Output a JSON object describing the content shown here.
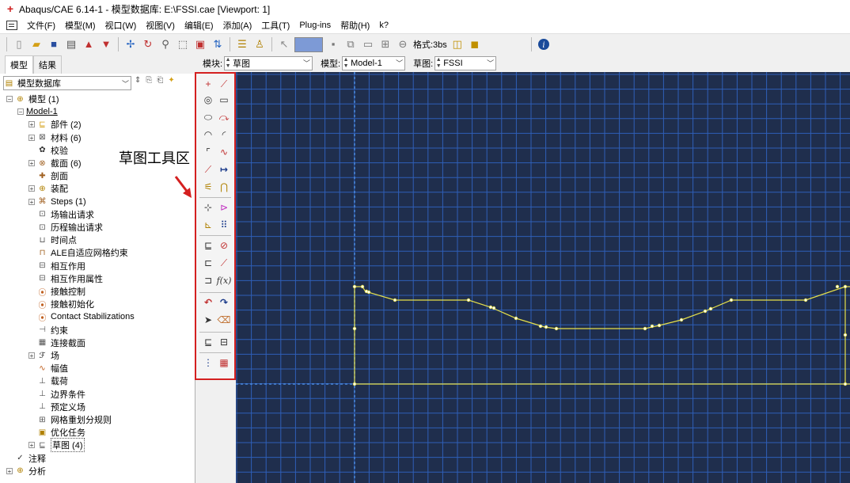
{
  "window": {
    "title": "Abaqus/CAE 6.14-1 - 模型数据库: E:\\FSSI.cae [Viewport: 1]"
  },
  "menu": [
    "文件(F)",
    "模型(M)",
    "视口(W)",
    "视图(V)",
    "编辑(E)",
    "添加(A)",
    "工具(T)",
    "Plug-ins",
    "帮助(H)",
    "k?"
  ],
  "toolbar": {
    "format_label": "格式:3bs"
  },
  "tabs": [
    "模型",
    "结果"
  ],
  "context": {
    "module_label": "模块:",
    "module_value": "草图",
    "model_label": "模型:",
    "model_value": "Model-1",
    "sketch_label": "草图:",
    "sketch_value": "FSSI"
  },
  "model_db_label": "模型数据库",
  "tree": [
    {
      "label": "模型 (1)",
      "icon": "models-icon"
    },
    {
      "label": "Model-1",
      "icon": ""
    },
    {
      "label": "部件 (2)",
      "icon": "parts-icon"
    },
    {
      "label": "材料 (6)",
      "icon": "materials-icon"
    },
    {
      "label": "校验",
      "icon": "calibration-icon"
    },
    {
      "label": "截面 (6)",
      "icon": "sections-icon"
    },
    {
      "label": "剖面",
      "icon": "profiles-icon"
    },
    {
      "label": "装配",
      "icon": "assembly-icon"
    },
    {
      "label": "Steps (1)",
      "icon": "steps-icon"
    },
    {
      "label": "场输出请求",
      "icon": "field-output-icon"
    },
    {
      "label": "历程输出请求",
      "icon": "history-output-icon"
    },
    {
      "label": "时间点",
      "icon": "time-points-icon"
    },
    {
      "label": "ALE自适应网格约束",
      "icon": "ale-icon"
    },
    {
      "label": "相互作用",
      "icon": "interactions-icon"
    },
    {
      "label": "相互作用属性",
      "icon": "interaction-props-icon"
    },
    {
      "label": "接触控制",
      "icon": "contact-controls-icon"
    },
    {
      "label": "接触初始化",
      "icon": "contact-init-icon"
    },
    {
      "label": "Contact Stabilizations",
      "icon": "contact-stab-icon"
    },
    {
      "label": "约束",
      "icon": "constraints-icon"
    },
    {
      "label": "连接截面",
      "icon": "connector-sections-icon"
    },
    {
      "label": "场",
      "icon": "fields-icon"
    },
    {
      "label": "幅值",
      "icon": "amplitudes-icon"
    },
    {
      "label": "载荷",
      "icon": "loads-icon"
    },
    {
      "label": "边界条件",
      "icon": "bcs-icon"
    },
    {
      "label": "预定义场",
      "icon": "predefined-fields-icon"
    },
    {
      "label": "网格重划分规则",
      "icon": "remesh-icon"
    },
    {
      "label": "优化任务",
      "icon": "optimization-icon"
    },
    {
      "label": "草图 (4)",
      "icon": "sketches-icon"
    },
    {
      "label": "注释",
      "icon": "annotations-icon"
    },
    {
      "label": "分析",
      "icon": "analysis-icon"
    }
  ],
  "annotation": {
    "label": "草图工具区"
  },
  "colors": {
    "viewport_bg": "#1f2e4d",
    "grid": "#2f5fb8",
    "sketch": "#e6e04a",
    "highlight_box": "#d42020"
  }
}
